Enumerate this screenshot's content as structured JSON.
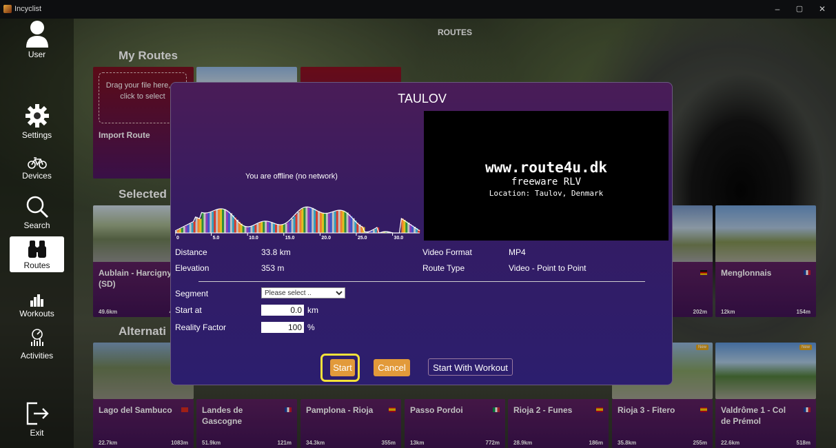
{
  "window": {
    "title": "Incyclist",
    "minimize": "–",
    "restore": "▢",
    "close": "✕"
  },
  "sidebar": {
    "items": [
      {
        "label": "User"
      },
      {
        "label": "Settings"
      },
      {
        "label": "Devices"
      },
      {
        "label": "Search"
      },
      {
        "label": "Routes"
      },
      {
        "label": "Workouts"
      },
      {
        "label": "Activities"
      },
      {
        "label": "Exit"
      }
    ]
  },
  "page": {
    "title": "ROUTES"
  },
  "sections": {
    "my_routes": "My Routes",
    "selected": "Selected For Me",
    "alternatives": "Alternati"
  },
  "import_card": {
    "drop_text": "Drag your file here, or click to select",
    "title": "Import Route"
  },
  "cards": {
    "aublain": {
      "name": "Aublain - Harcigny (SD)",
      "distance": "49.6km",
      "elevation": "476"
    },
    "menglonnais": {
      "name": "Menglonnais",
      "distance": "12km",
      "elevation": "154m"
    },
    "row2_partial": {
      "elevation": "202m"
    },
    "bottom": [
      {
        "name": "Lago del Sambuco",
        "distance": "22.7km",
        "elevation": "1083m"
      },
      {
        "name": "Landes de Gascogne",
        "distance": "51.9km",
        "elevation": "121m"
      },
      {
        "name": "Pamplona - Rioja",
        "distance": "34.3km",
        "elevation": "355m"
      },
      {
        "name": "Passo Pordoi",
        "distance": "13km",
        "elevation": "772m"
      },
      {
        "name": "Rioja 2 - Funes",
        "distance": "28.9km",
        "elevation": "186m"
      },
      {
        "name": "Rioja 3 - Fitero",
        "distance": "35.8km",
        "elevation": "255m"
      },
      {
        "name": "Valdrôme 1 - Col de Prémol",
        "distance": "22.6km",
        "elevation": "518m"
      }
    ],
    "new_badge": "New"
  },
  "modal": {
    "title": "TAULOV",
    "offline": "You are offline (no network)",
    "profile_ticks": [
      "0",
      "5.0",
      "10.0",
      "15.0",
      "20.0",
      "25.0",
      "30.0"
    ],
    "video": {
      "line1": "www.route4u.dk",
      "line2": "freeware RLV",
      "line3": "Location: Taulov, Denmark"
    },
    "distance_label": "Distance",
    "distance_value": "33.8 km",
    "elevation_label": "Elevation",
    "elevation_value": "353 m",
    "video_format_label": "Video Format",
    "video_format_value": "MP4",
    "route_type_label": "Route Type",
    "route_type_value": "Video - Point to Point",
    "segment_label": "Segment",
    "segment_selected": "Please select ..",
    "start_at_label": "Start at",
    "start_at_value": "0.0",
    "start_at_unit": "km",
    "reality_label": "Reality Factor",
    "reality_value": "100",
    "reality_unit": "%",
    "start_button": "Start",
    "cancel_button": "Cancel",
    "workout_button": "Start With Workout"
  },
  "colors": {
    "accent": "#e29a3a",
    "highlight": "#f4e23a",
    "card_info": "#4a1858",
    "modal_top": "#4a1c57",
    "modal_bottom": "#2c1e6e"
  }
}
